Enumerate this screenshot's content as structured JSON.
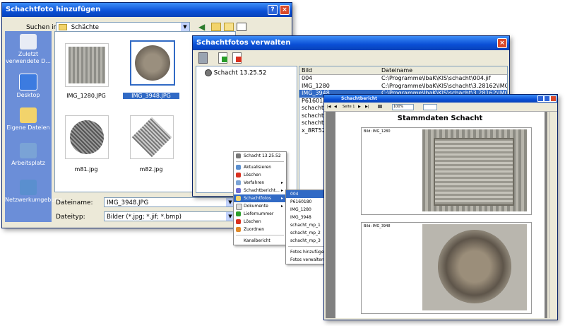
{
  "dialog1": {
    "title": "Schachtfoto hinzufügen",
    "help_symbol": "?",
    "close_symbol": "×",
    "lookin_label": "Suchen in:",
    "lookin_value": "Schächte",
    "places": [
      "Zuletzt verwendete D...",
      "Desktop",
      "Eigene Dateien",
      "Arbeitsplatz",
      "Netzwerkumgebung"
    ],
    "files": [
      "IMG_1280.JPG",
      "IMG_3948.JPG",
      "m81.jpg",
      "m82.jpg"
    ],
    "filename_label": "Dateiname:",
    "filename_value": "IMG_3948.JPG",
    "filetype_label": "Dateityp:",
    "filetype_value": "Bilder (*.jpg; *.jif; *.bmp)"
  },
  "dialog2": {
    "title": "Schachtfotos verwalten",
    "tree_item": "Schacht 13.25.52",
    "col_name": "Bild",
    "col_file": "Dateiname",
    "rows": [
      {
        "name": "004",
        "file": "C:\\Programme\\IbaK\\KIS\\schacht\\004.jif"
      },
      {
        "name": "IMG_1280",
        "file": "C:\\Programme\\IbaK\\KIS\\schacht\\3.28162\\IMG..."
      },
      {
        "name": "IMG_3948",
        "file": "C:\\Programme\\IbaK\\KIS\\schacht\\3.28162\\IMG..."
      },
      {
        "name": "P6160180",
        "file": ""
      },
      {
        "name": "schacht...",
        "file": ""
      },
      {
        "name": "schacht...",
        "file": ""
      },
      {
        "name": "schacht...",
        "file": ""
      },
      {
        "name": "x_8RT52",
        "file": ""
      }
    ]
  },
  "context_menu": {
    "items": [
      "Schacht 13.25.52",
      "Aktualisieren",
      "Löschen",
      "Verfahren",
      "Schachtbericht...",
      "Schachtfotos",
      "Dokumente",
      "Liefernummer",
      "Löschen",
      "Zuordnen",
      "Kanalbericht"
    ]
  },
  "submenu": {
    "items": [
      "004",
      "P6160180",
      "IMG_1280",
      "IMG_3948",
      "schacht_mp_1",
      "schacht_mp_2",
      "schacht_mp_3",
      "Fotos hinzufügen",
      "Fotos verwalten"
    ]
  },
  "report": {
    "title": "Stammdaten Schacht",
    "window_title": "Schachtbericht",
    "page_label": "Seite 1",
    "zoom": "100%",
    "caption1": "Bild: IMG_1280",
    "caption2": "Bild: IMG_3948"
  }
}
